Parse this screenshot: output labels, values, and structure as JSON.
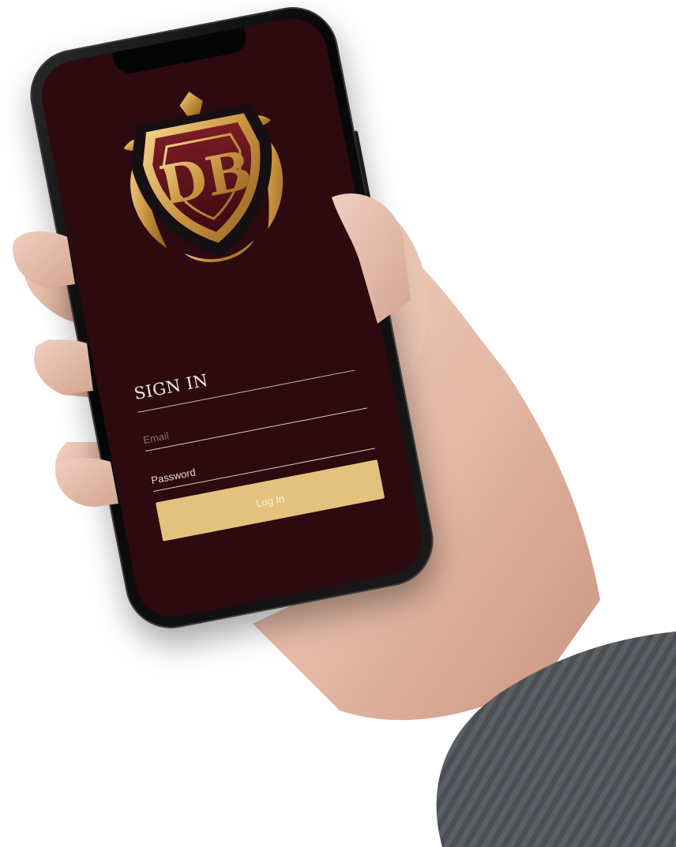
{
  "login": {
    "title": "SIGN IN",
    "email_placeholder": "Email",
    "password_placeholder": "Password",
    "button_label": "Log In"
  },
  "logo": {
    "monogram": "DB",
    "icon": "crest-shield-logo"
  },
  "colors": {
    "screen_background": "#2d0a0f",
    "accent_gold": "#e2c27d",
    "title_text": "#f3ece6"
  }
}
